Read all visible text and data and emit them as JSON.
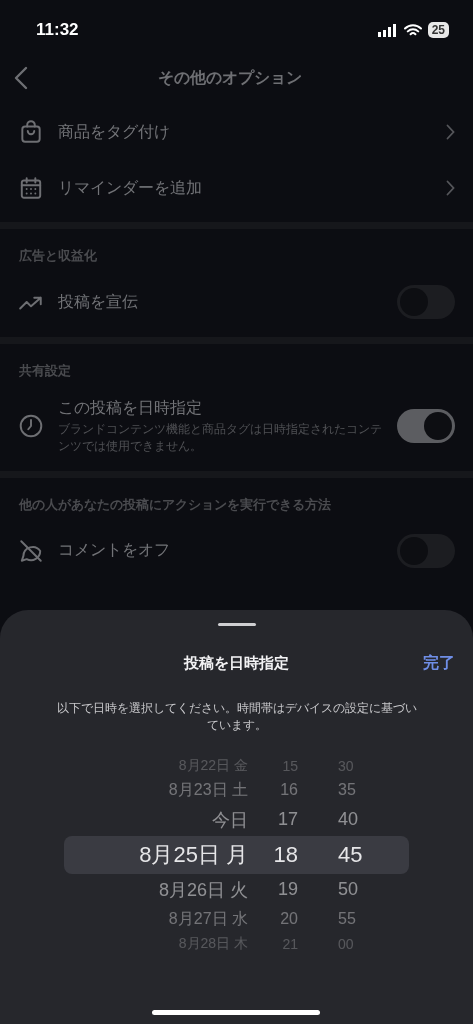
{
  "status_bar": {
    "time": "11:32",
    "battery": "25"
  },
  "header": {
    "title": "その他のオプション"
  },
  "sections": [
    {
      "rows": [
        {
          "kind": "link",
          "label": "商品をタグ付け"
        },
        {
          "kind": "link",
          "label": "リマインダーを追加"
        }
      ]
    },
    {
      "title": "広告と収益化",
      "rows": [
        {
          "kind": "toggle",
          "label": "投稿を宣伝",
          "on": false
        }
      ]
    },
    {
      "title": "共有設定",
      "rows": [
        {
          "kind": "toggle",
          "label": "この投稿を日時指定",
          "note": "ブランドコンテンツ機能と商品タグは日時指定されたコンテンツでは使用できません。",
          "on": true
        }
      ]
    },
    {
      "title": "他の人があなたの投稿にアクションを実行できる方法",
      "rows": [
        {
          "kind": "toggle",
          "label": "コメントをオフ",
          "on": false
        }
      ]
    }
  ],
  "sheet": {
    "title": "投稿を日時指定",
    "done": "完了",
    "description": "以下で日時を選択してください。時間帯はデバイスの設定に基づいています。",
    "picker": [
      {
        "date": "8月22日 金",
        "hour": "15",
        "minute": "30",
        "selected": false
      },
      {
        "date": "8月23日 土",
        "hour": "16",
        "minute": "35",
        "selected": false
      },
      {
        "date": "今日",
        "hour": "17",
        "minute": "40",
        "selected": false
      },
      {
        "date": "8月25日 月",
        "hour": "18",
        "minute": "45",
        "selected": true
      },
      {
        "date": "8月26日 火",
        "hour": "19",
        "minute": "50",
        "selected": false
      },
      {
        "date": "8月27日 水",
        "hour": "20",
        "minute": "55",
        "selected": false
      },
      {
        "date": "8月28日 木",
        "hour": "21",
        "minute": "00",
        "selected": false
      }
    ]
  }
}
